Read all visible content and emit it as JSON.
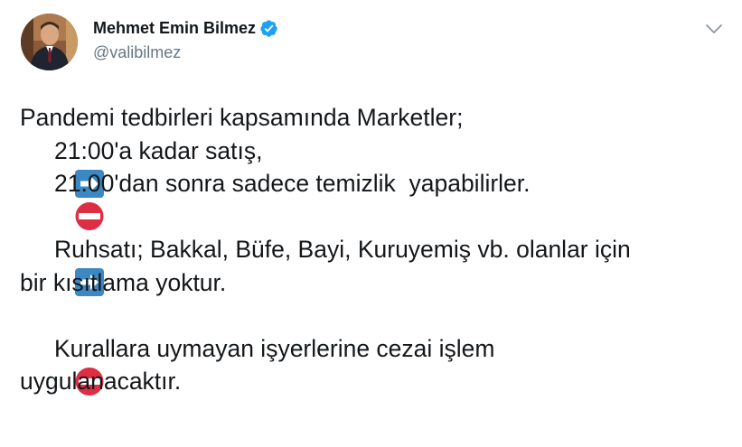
{
  "author": {
    "display_name": "Mehmet Emin Bilmez",
    "handle": "@valibilmez",
    "verified": true,
    "avatar": "profile-photo"
  },
  "icons": {
    "verified": "verified-badge-icon",
    "caret": "chevron-down-icon",
    "arrow_emoji": "right-arrow-emoji",
    "no_entry_emoji": "no-entry-emoji"
  },
  "colors": {
    "accent": "#1da1f2",
    "text": "#14171a",
    "muted": "#657786",
    "arrow_emoji_bg": "#3b88c3",
    "no_entry_emoji_bg": "#dd2e44"
  },
  "tweet": {
    "line1": "Pandemi tedbirleri kapsamında Marketler;",
    "line2": "21:00'a kadar satış,",
    "line3": "21.00'dan sonra sadece temizlik  yapabilirler.",
    "line4": "Ruhsatı; Bakkal, Büfe, Bayi, Kuruyemiş vb. olanlar için",
    "line5": "bir kısıtlama yoktur.",
    "line6": "Kurallara uymayan işyerlerine cezai işlem",
    "line7": "uygulanacaktır."
  }
}
